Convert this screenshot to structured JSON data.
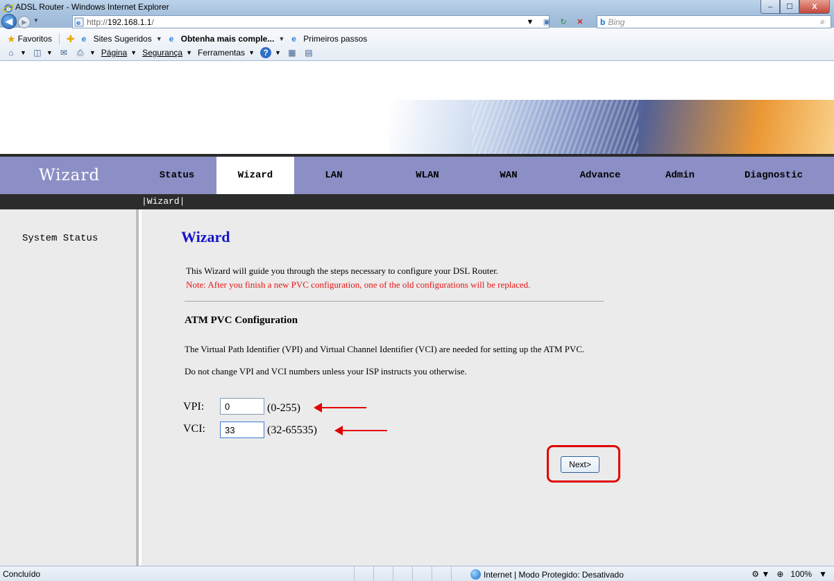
{
  "window": {
    "title": "ADSL Router - Windows Internet Explorer",
    "controls": {
      "minimize": "–",
      "maximize": "☐",
      "close": "X"
    }
  },
  "address_bar": {
    "url_proto": "http://",
    "url_host": "192.168.1.1",
    "url_rest": "/",
    "search_placeholder": "Bing",
    "search_logo": "b"
  },
  "favorites_bar": {
    "favorites_label": "Favoritos",
    "items": [
      "Sites Sugeridos",
      "Obtenha mais comple...",
      "Primeiros passos"
    ]
  },
  "command_bar": {
    "pagina": "Página",
    "seguranca": "Segurança",
    "ferramentas": "Ferramentas"
  },
  "router": {
    "brand": "Wizard",
    "tabs": [
      "Status",
      "Wizard",
      "LAN",
      "WLAN",
      "WAN",
      "Advance",
      "Admin",
      "Diagnostic"
    ],
    "active_tab": "Wizard",
    "breadcrumb": "|Wizard|",
    "sidebar_items": [
      "System Status"
    ]
  },
  "content": {
    "title": "Wizard",
    "intro": "This Wizard will guide you through the steps necessary to configure your DSL Router.",
    "note": "Note: After you finish a new PVC configuration, one of the old configurations will be replaced.",
    "section_title": "ATM PVC Configuration",
    "description": "The Virtual Path Identifier (VPI) and Virtual Channel Identifier (VCI) are needed for setting up the ATM PVC.",
    "description2": "Do not change VPI and VCI numbers unless your ISP instructs you otherwise.",
    "vpi": {
      "label": "VPI:",
      "value": "0",
      "range": "(0-255)"
    },
    "vci": {
      "label": "VCI:",
      "value": "33",
      "range": "(32-65535)"
    },
    "next_button": "Next>"
  },
  "status_bar": {
    "left": "Concluído",
    "zone": "Internet | Modo Protegido: Desativado",
    "zoom": "100%"
  },
  "colors": {
    "nav_bg": "#8c8fc5",
    "title_blue": "#1515c8",
    "note_red": "#e81414",
    "highlight_red": "#e00000"
  }
}
